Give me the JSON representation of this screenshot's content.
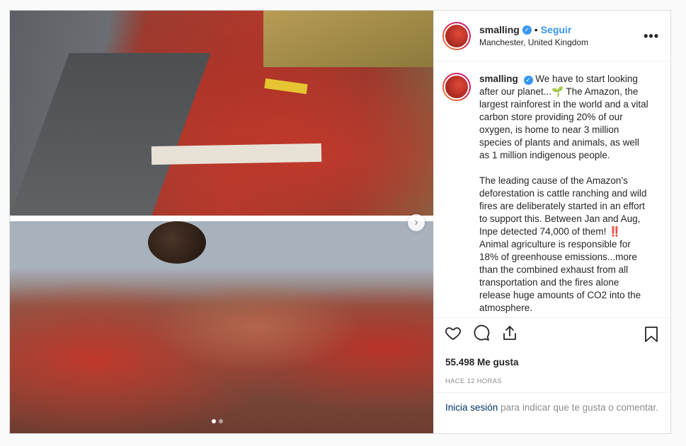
{
  "post": {
    "username": "smalling",
    "follow_label": "Seguir",
    "separator": "•",
    "location": "Manchester, United Kingdom",
    "more_label": "•••",
    "caption_p1": "We have to start looking after our planet...🌱 The Amazon, the largest rainforest in the world and a vital carbon store providing 20% of our oxygen, is home to near 3 million species of plants and animals, as well as 1 million indigenous people.",
    "caption_p2": "The leading cause of the Amazon’s deforestation is cattle ranching and wild fires are deliberately started in an effort to support this. Between Jan and Aug, Inpe detected 74,000 of them! ‼️ Animal agriculture is responsible for 18% of greenhouse emissions...more than the combined exhaust from all transportation and the fires alone release huge amounts of CO2 into the atmosphere.",
    "likes": "55.498 Me gusta",
    "timestamp": "HACE 12 HORAS",
    "login_link": "Inicia sesión",
    "login_text": " para indicar que te gusta o comentar."
  },
  "media": {
    "next_label": "›",
    "carousel_total": 2,
    "carousel_active": 1
  },
  "icons": {
    "verified": "verified-badge-icon",
    "like": "heart-icon",
    "comment": "comment-icon",
    "share": "share-icon",
    "save": "bookmark-icon"
  },
  "colors": {
    "link": "#3897f0",
    "border": "#dbdbdb",
    "muted": "#8e8e8e",
    "login_link": "#003569"
  }
}
